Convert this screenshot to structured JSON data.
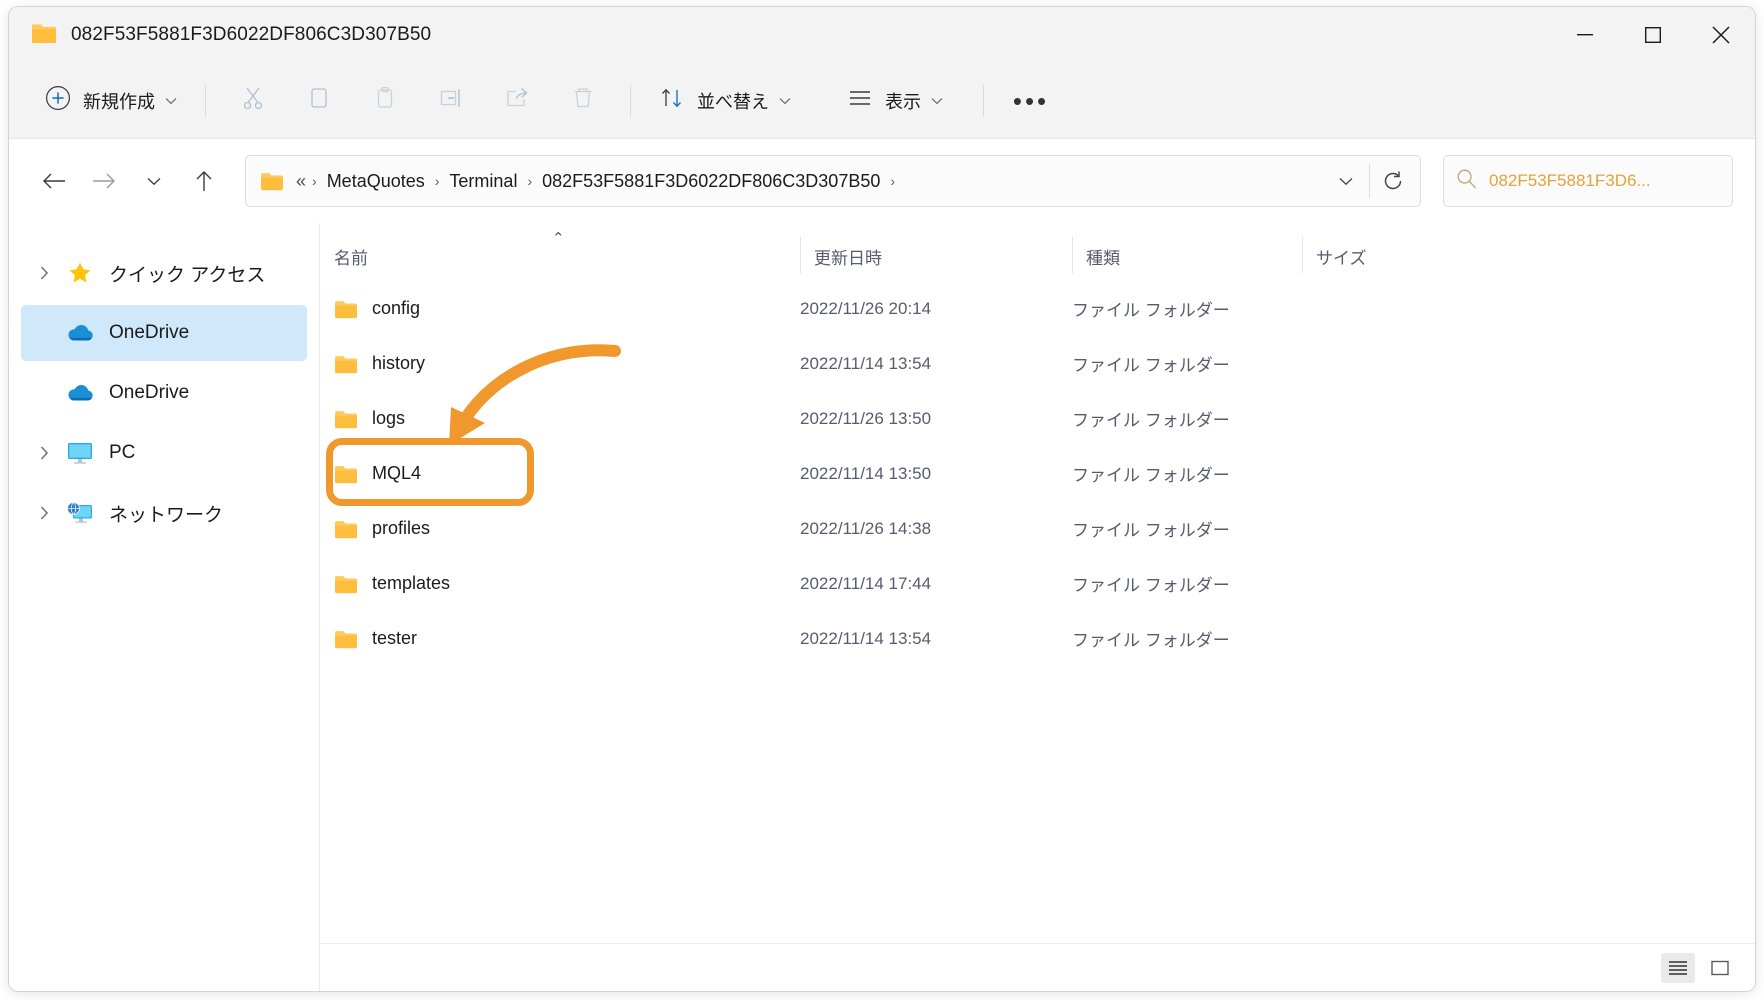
{
  "window": {
    "title": "082F53F5881F3D6022DF806C3D307B50",
    "minimize_label": "最小化",
    "maximize_label": "最大化",
    "close_label": "閉じる"
  },
  "toolbar": {
    "new_label": "新規作成",
    "cut_label": "切り取り",
    "copy_label": "コピー",
    "paste_label": "貼り付け",
    "rename_label": "名前の変更",
    "share_label": "共有",
    "delete_label": "削除",
    "sort_label": "並べ替え",
    "view_label": "表示",
    "more_label": "•••"
  },
  "address": {
    "back_label": "戻る",
    "forward_label": "進む",
    "recent_label": "最近の場所",
    "up_label": "上へ",
    "leading_ellipsis": "«",
    "crumbs": [
      "MetaQuotes",
      "Terminal",
      "082F53F5881F3D6022DF806C3D307B50"
    ],
    "separator": "›",
    "refresh_label": "更新",
    "dropdown_label": "履歴"
  },
  "search": {
    "value": "082F53F5881F3D6...",
    "placeholder": "082F53F5881F3D6..."
  },
  "sidebar": {
    "items": [
      {
        "label": "クイック アクセス",
        "icon": "star-icon",
        "expandable": true,
        "selected": false
      },
      {
        "label": "OneDrive",
        "icon": "cloud-icon",
        "expandable": false,
        "selected": true
      },
      {
        "label": "OneDrive",
        "icon": "cloud-icon",
        "expandable": false,
        "selected": false
      },
      {
        "label": "PC",
        "icon": "monitor-icon",
        "expandable": true,
        "selected": false
      },
      {
        "label": "ネットワーク",
        "icon": "network-icon",
        "expandable": true,
        "selected": false
      }
    ]
  },
  "columns": {
    "name": "名前",
    "date": "更新日時",
    "type": "種類",
    "size": "サイズ",
    "sort_indicator": "⌃"
  },
  "files": [
    {
      "name": "config",
      "date": "2022/11/26 20:14",
      "type": "ファイル フォルダー",
      "size": ""
    },
    {
      "name": "history",
      "date": "2022/11/14 13:54",
      "type": "ファイル フォルダー",
      "size": ""
    },
    {
      "name": "logs",
      "date": "2022/11/26 13:50",
      "type": "ファイル フォルダー",
      "size": ""
    },
    {
      "name": "MQL4",
      "date": "2022/11/14 13:50",
      "type": "ファイル フォルダー",
      "size": ""
    },
    {
      "name": "profiles",
      "date": "2022/11/26 14:38",
      "type": "ファイル フォルダー",
      "size": ""
    },
    {
      "name": "templates",
      "date": "2022/11/14 17:44",
      "type": "ファイル フォルダー",
      "size": ""
    },
    {
      "name": "tester",
      "date": "2022/11/14 13:54",
      "type": "ファイル フォルダー",
      "size": ""
    }
  ],
  "statusbar": {
    "details_view_label": "詳細",
    "large_icons_view_label": "大アイコン"
  },
  "annotation": {
    "target_row": "MQL4",
    "color": "#f0982d"
  }
}
